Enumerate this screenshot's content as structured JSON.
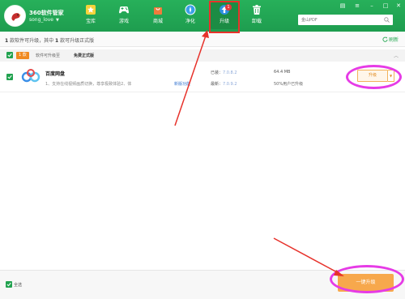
{
  "header": {
    "app_title": "360软件管家",
    "user_name": "song_love",
    "nav": [
      {
        "label": "宝库",
        "icon": "star-icon"
      },
      {
        "label": "游戏",
        "icon": "gamepad-icon"
      },
      {
        "label": "商城",
        "icon": "shopping-bag-icon"
      },
      {
        "label": "净化",
        "icon": "compass-icon"
      },
      {
        "label": "升级",
        "icon": "upload-arrow-icon",
        "badge": "1",
        "active": true
      },
      {
        "label": "卸载",
        "icon": "trash-icon"
      }
    ],
    "search_placeholder": "金山PDF",
    "colors": {
      "header_green": "#22a556",
      "active_green": "#1c8c44",
      "badge_red": "#e5373b"
    }
  },
  "summary": {
    "count_a": "1",
    "text_a": "款软件可升级，其中",
    "count_b": "1",
    "text_b": "款可升级正式版",
    "refresh_label": "刷新"
  },
  "group": {
    "tag": "1 款",
    "label": "软件可升级至",
    "label_bold": "免费正式版"
  },
  "software": {
    "name": "百度网盘",
    "description": "1、支持在线视频画质切换，尊享极致体验2、体",
    "more_link": "新版功能",
    "installed_label": "已装：",
    "installed_version": "7.0.8.2",
    "latest_label": "最新：",
    "latest_version": "7.0.9.2",
    "size": "64.4 MB",
    "percent_text": "50%用户已升级",
    "upgrade_label": "升级"
  },
  "footer": {
    "select_all": "全选",
    "one_key_upgrade": "一键升级",
    "accent": "#f7a84c"
  }
}
